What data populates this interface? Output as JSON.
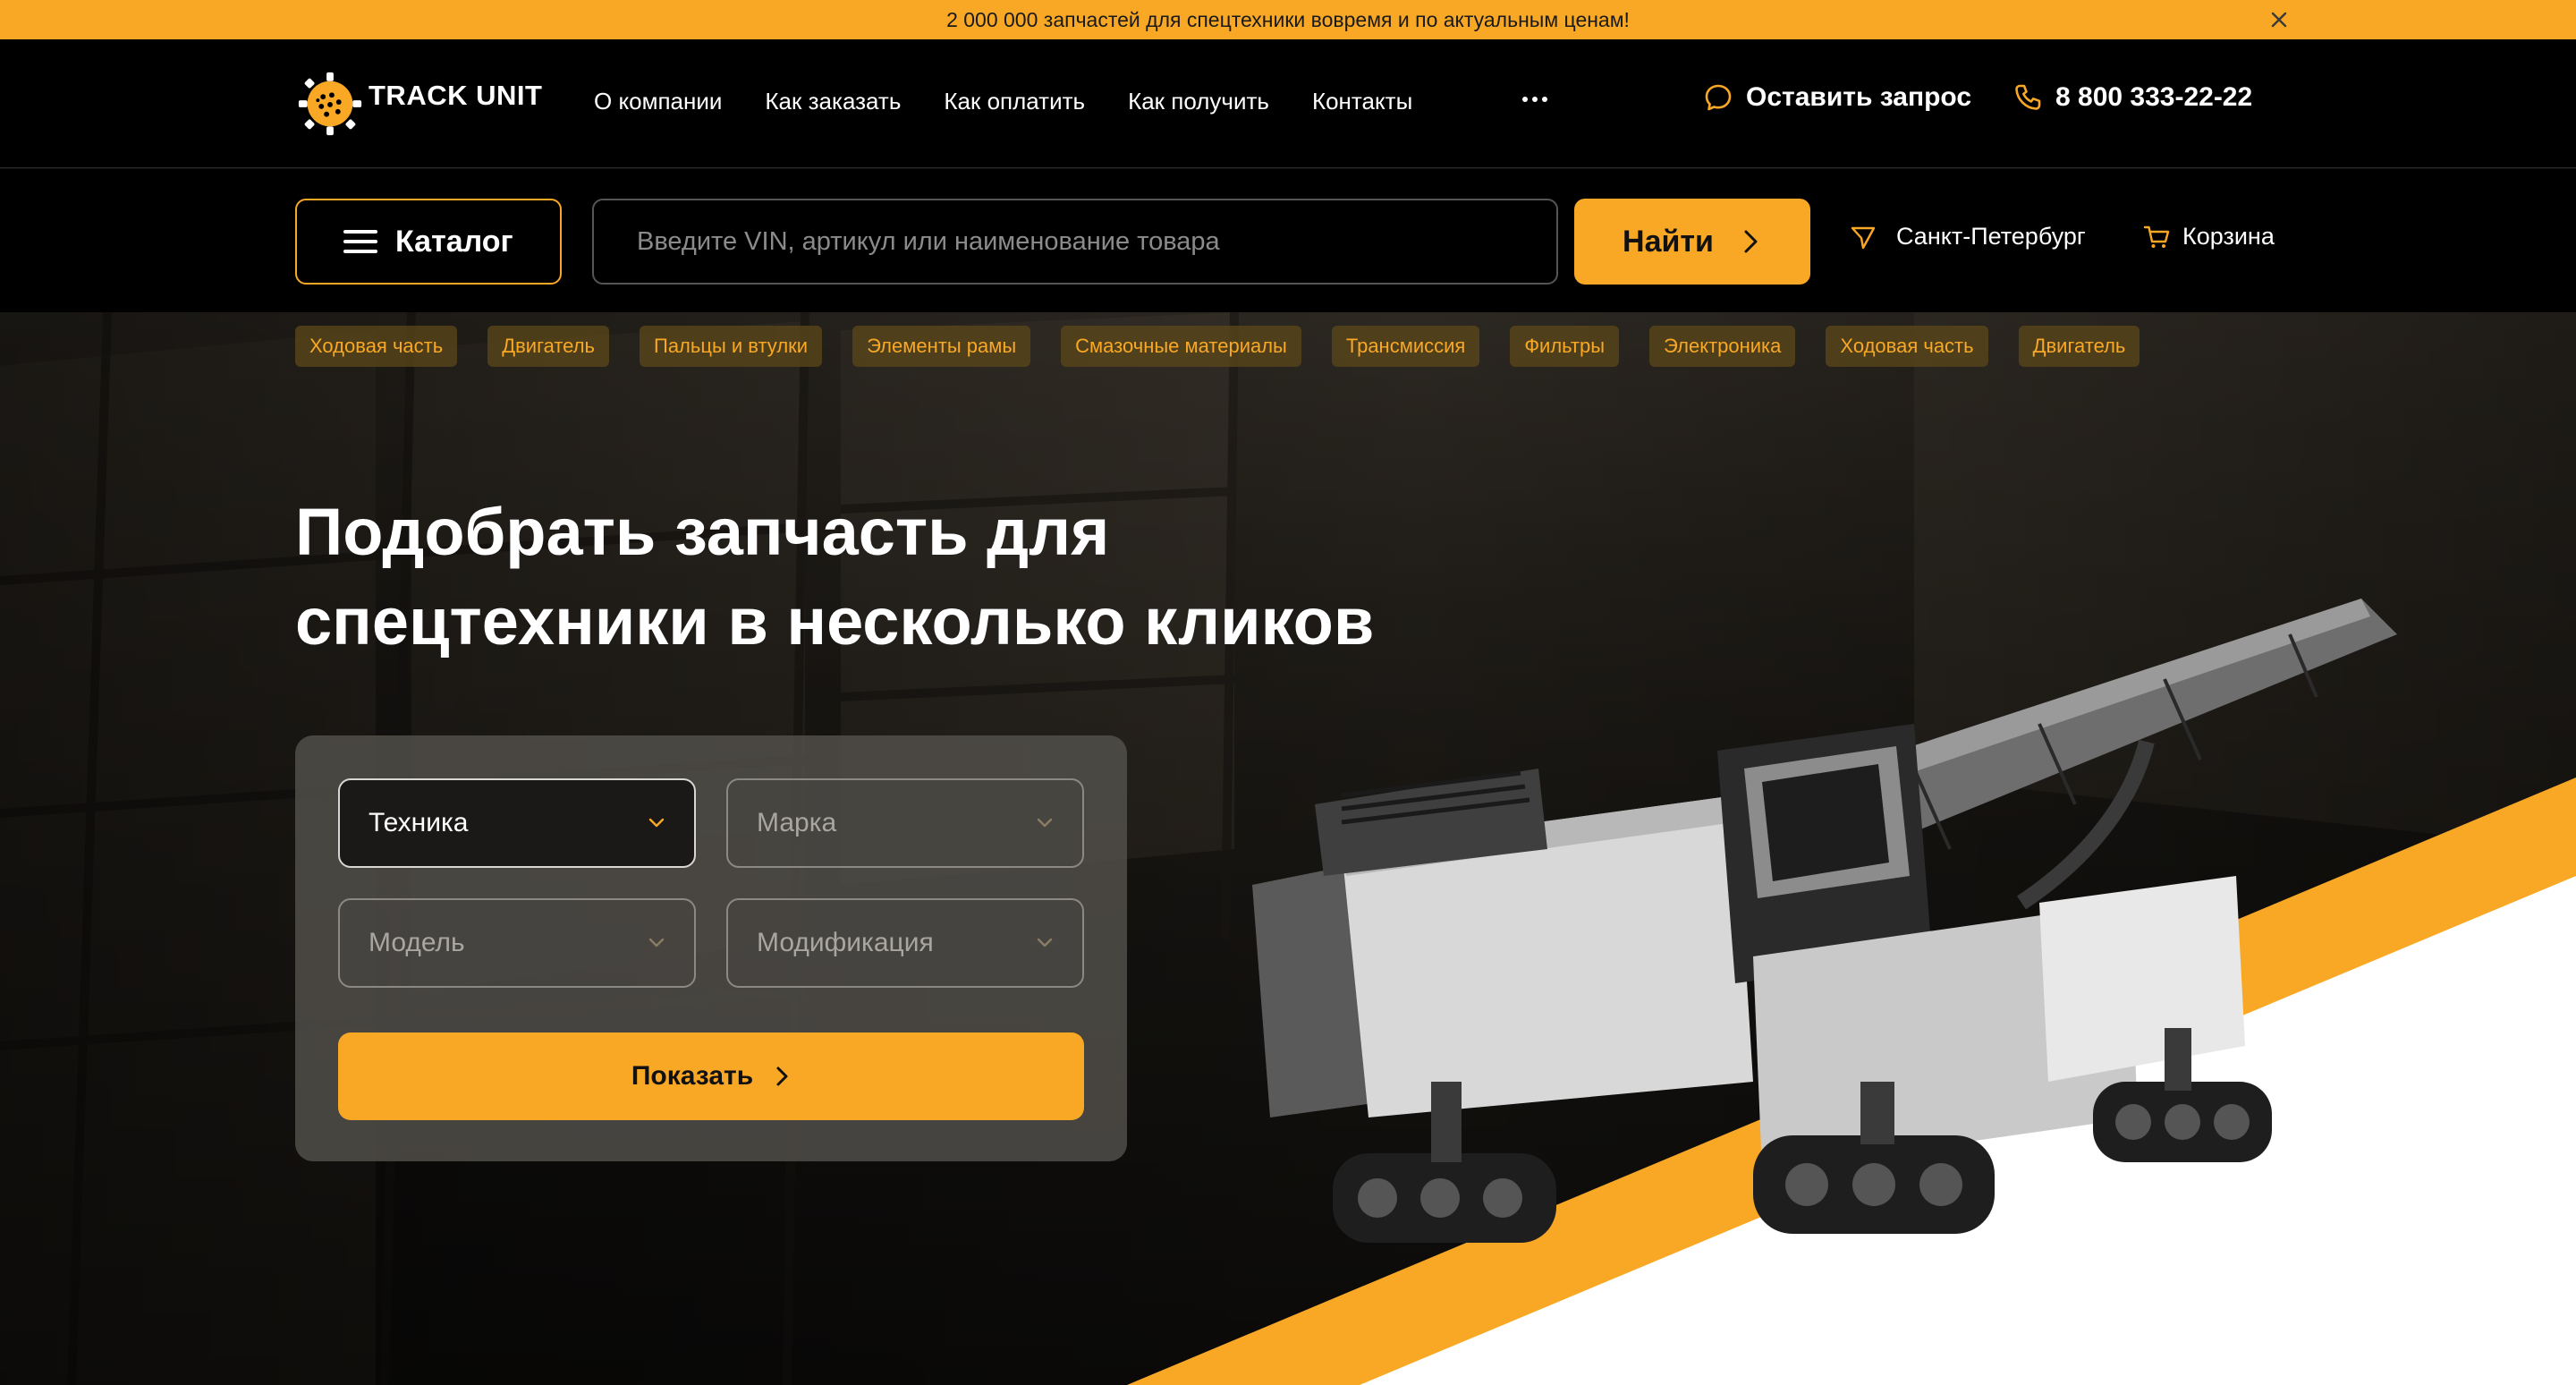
{
  "promo": {
    "text": "2 000 000 запчастей для спецтехники вовремя и по актуальным ценам!",
    "close_icon": "close-icon"
  },
  "header": {
    "logo_text": "TRACK UNIT",
    "nav": [
      {
        "label": "О компании"
      },
      {
        "label": "Как заказать"
      },
      {
        "label": "Как оплатить"
      },
      {
        "label": "Как получить"
      },
      {
        "label": "Контакты"
      }
    ],
    "more_icon": "more-dots-icon",
    "request_label": "Оставить запрос",
    "phone": "8 800 333-22-22"
  },
  "search": {
    "catalog_label": "Каталог",
    "placeholder": "Введите VIN, артикул или наименование товара",
    "find_label": "Найти",
    "city": "Санкт-Петербург",
    "cart_label": "Корзина"
  },
  "categories": [
    {
      "label": "Ходовая часть"
    },
    {
      "label": "Двигатель"
    },
    {
      "label": "Пальцы и втулки"
    },
    {
      "label": "Элементы рамы"
    },
    {
      "label": "Смазочные материалы"
    },
    {
      "label": "Трансмиссия"
    },
    {
      "label": "Фильтры"
    },
    {
      "label": "Электроника"
    },
    {
      "label": "Ходовая часть"
    },
    {
      "label": "Двигатель"
    }
  ],
  "hero": {
    "title_line1": "Подобрать запчасть для",
    "title_line2": "спецтехники в несколько кликов"
  },
  "filter": {
    "equipment": "Техника",
    "brand": "Марка",
    "model": "Модель",
    "modification": "Модификация",
    "show_label": "Показать"
  },
  "colors": {
    "accent": "#f9a825",
    "background": "#000000",
    "text": "#ffffff"
  }
}
